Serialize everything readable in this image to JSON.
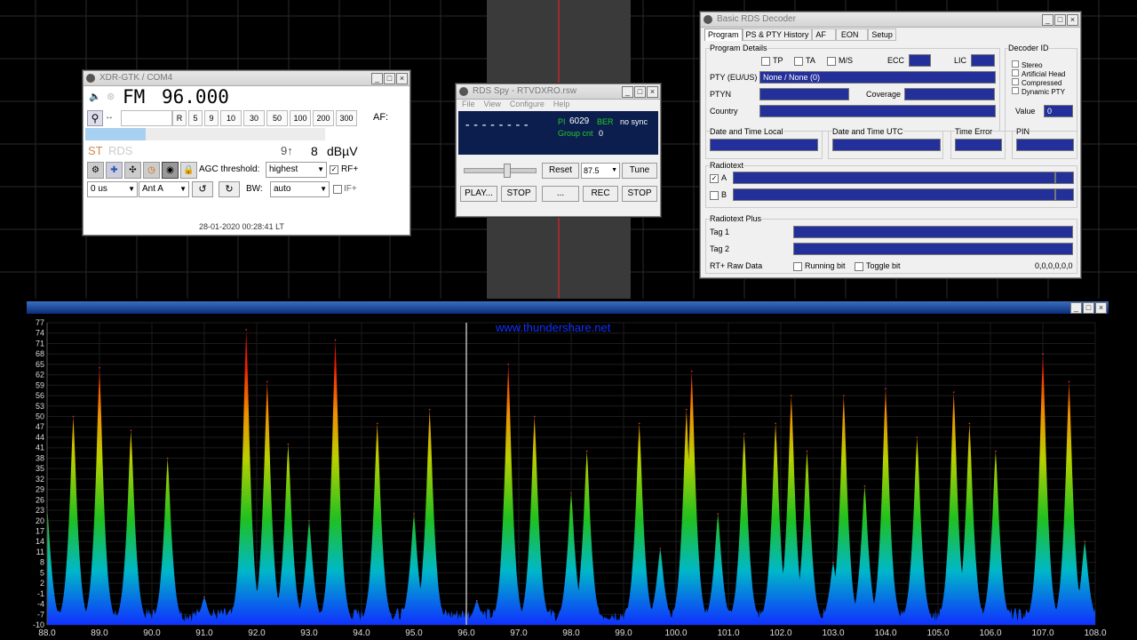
{
  "colors": {
    "accent_blue": "#23309a",
    "rds_bg": "#0b1e4e",
    "marker": "#ff2020",
    "link": "#1030ff"
  },
  "xdr": {
    "title": "XDR-GTK / COM4",
    "band": "FM",
    "freq": "96.000",
    "steps": [
      "R",
      "5",
      "9",
      "10",
      "30",
      "50",
      "100",
      "200",
      "300"
    ],
    "af_label": "AF:",
    "st": "ST",
    "rds": "RDS",
    "signal_num": "9↑",
    "signal_val": "8",
    "signal_unit": "dBµV",
    "agc_label": "AGC threshold:",
    "agc_value": "highest",
    "rf_label": "RF+",
    "deemph": "0 us",
    "ant": "Ant A",
    "bw_label": "BW:",
    "bw_value": "auto",
    "if_label": "IF+",
    "timestamp": "28-01-2020 00:28:41 LT"
  },
  "rdsspy": {
    "title": "RDS Spy - RTVDXRO.rsw",
    "menu": [
      "File",
      "View",
      "Configure",
      "Help"
    ],
    "ps": "--------",
    "pi_label": "PI",
    "pi_value": "6029",
    "ber_label": "BER",
    "sync": "no sync",
    "group_label": "Group cnt",
    "group_value": "0",
    "reset": "Reset",
    "freq_select": "87.5",
    "tune": "Tune",
    "play": "PLAY...",
    "stop1": "STOP",
    "dots": "...",
    "rec": "REC",
    "stop2": "STOP"
  },
  "rdsdec": {
    "title": "Basic RDS Decoder",
    "tabs": [
      "Program",
      "PS & PTY History",
      "AF",
      "EON",
      "Setup"
    ],
    "program_details": "Program Details",
    "tp": "TP",
    "ta": "TA",
    "ms": "M/S",
    "ecc": "ECC",
    "lic": "LIC",
    "pty_label": "PTY (EU/US)",
    "pty_value": "None / None (0)",
    "ptyn_label": "PTYN",
    "coverage_label": "Coverage",
    "country_label": "Country",
    "decoder_id": "Decoder ID",
    "did_items": [
      "Stereo",
      "Artificial Head",
      "Compressed",
      "Dynamic PTY"
    ],
    "value_label": "Value",
    "value": "0",
    "dt_local": "Date and Time Local",
    "dt_utc": "Date and Time UTC",
    "time_error": "Time Error",
    "pin": "PIN",
    "radiotext": "Radiotext",
    "rt_a": "A",
    "rt_b": "B",
    "rtplus": "Radiotext Plus",
    "tag1": "Tag 1",
    "tag2": "Tag 2",
    "raw_label": "RT+ Raw Data",
    "running": "Running bit",
    "toggle": "Toggle bit",
    "raw_value": "0,0,0,0,0,0"
  },
  "spectrum": {
    "watermark": "www.thundershare.net",
    "y_ticks": [
      "77",
      "74",
      "71",
      "68",
      "65",
      "62",
      "59",
      "56",
      "53",
      "50",
      "47",
      "44",
      "41",
      "38",
      "35",
      "32",
      "29",
      "26",
      "23",
      "20",
      "17",
      "14",
      "11",
      "8",
      "5",
      "2",
      "-1",
      "-4",
      "-7",
      "-10"
    ],
    "x_ticks": [
      "88.0",
      "89.0",
      "90.0",
      "91.0",
      "92.0",
      "93.0",
      "94.0",
      "95.0",
      "96.0",
      "97.0",
      "98.0",
      "99.0",
      "100.0",
      "101.0",
      "102.0",
      "103.0",
      "104.0",
      "105.0",
      "106.0",
      "107.0",
      "108.0"
    ],
    "cursor_mhz": 96.0,
    "peaks": [
      [
        88.0,
        24
      ],
      [
        88.5,
        50
      ],
      [
        89.0,
        64
      ],
      [
        89.6,
        46
      ],
      [
        90.3,
        38
      ],
      [
        91.0,
        -2
      ],
      [
        91.8,
        75
      ],
      [
        92.2,
        60
      ],
      [
        92.6,
        42
      ],
      [
        93.0,
        20
      ],
      [
        93.5,
        72
      ],
      [
        94.3,
        48
      ],
      [
        95.0,
        22
      ],
      [
        95.3,
        52
      ],
      [
        96.2,
        -3
      ],
      [
        96.8,
        65
      ],
      [
        97.3,
        50
      ],
      [
        98.0,
        28
      ],
      [
        98.3,
        40
      ],
      [
        99.3,
        48
      ],
      [
        99.7,
        12
      ],
      [
        100.2,
        52
      ],
      [
        100.3,
        63
      ],
      [
        100.8,
        22
      ],
      [
        101.3,
        45
      ],
      [
        101.9,
        48
      ],
      [
        102.2,
        56
      ],
      [
        102.5,
        40
      ],
      [
        103.0,
        8
      ],
      [
        103.2,
        56
      ],
      [
        103.6,
        30
      ],
      [
        104.0,
        58
      ],
      [
        104.6,
        44
      ],
      [
        105.3,
        57
      ],
      [
        105.6,
        48
      ],
      [
        106.1,
        40
      ],
      [
        107.0,
        68
      ],
      [
        107.5,
        60
      ],
      [
        107.8,
        14
      ]
    ]
  }
}
